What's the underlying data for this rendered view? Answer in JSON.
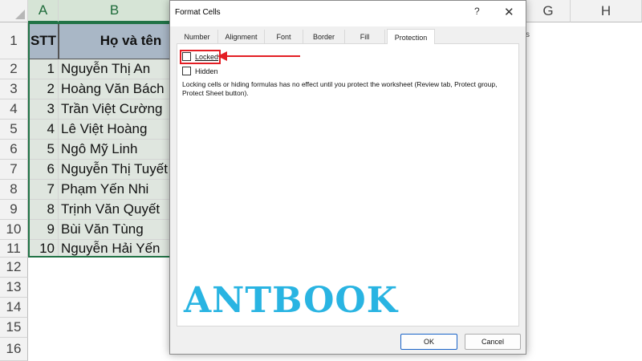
{
  "sheet": {
    "columns": [
      "A",
      "B",
      "",
      "",
      "",
      "",
      "",
      "G",
      "H"
    ],
    "row_numbers": [
      "1",
      "2",
      "3",
      "4",
      "5",
      "6",
      "7",
      "8",
      "9",
      "10",
      "11",
      "12",
      "13",
      "14",
      "15",
      "16"
    ],
    "header": {
      "stt": "STT",
      "name": "Họ và tên"
    },
    "rows": [
      {
        "stt": "1",
        "name": "Nguyễn Thị An"
      },
      {
        "stt": "2",
        "name": "Hoàng Văn Bách"
      },
      {
        "stt": "3",
        "name": "Trần Việt Cường"
      },
      {
        "stt": "4",
        "name": "Lê Việt Hoàng"
      },
      {
        "stt": "5",
        "name": "Ngô Mỹ Linh"
      },
      {
        "stt": "6",
        "name": "Nguyễn Thị Tuyết"
      },
      {
        "stt": "7",
        "name": "Phạm Yến Nhi"
      },
      {
        "stt": "8",
        "name": "Trịnh Văn Quyết"
      },
      {
        "stt": "9",
        "name": "Bùi Văn Tùng"
      },
      {
        "stt": "10",
        "name": "Nguyễn Hải Yến"
      }
    ],
    "peek_text": "s"
  },
  "dialog": {
    "title": "Format Cells",
    "help_label": "?",
    "close_label": "✕",
    "tabs": [
      "Number",
      "Alignment",
      "Font",
      "Border",
      "Fill",
      "Protection"
    ],
    "active_tab": "Protection",
    "locked_label": "Locked",
    "locked_checked": false,
    "hidden_label": "Hidden",
    "hidden_checked": false,
    "info": "Locking cells or hiding formulas has no effect until you protect the worksheet (Review tab, Protect group, Protect Sheet button).",
    "ok_label": "OK",
    "cancel_label": "Cancel"
  },
  "watermark": "ANTBOOK",
  "colors": {
    "accent": "#217346",
    "annotation": "#e31e24",
    "watermark": "#29b4e2",
    "header_fill": "#a9b7c6"
  }
}
